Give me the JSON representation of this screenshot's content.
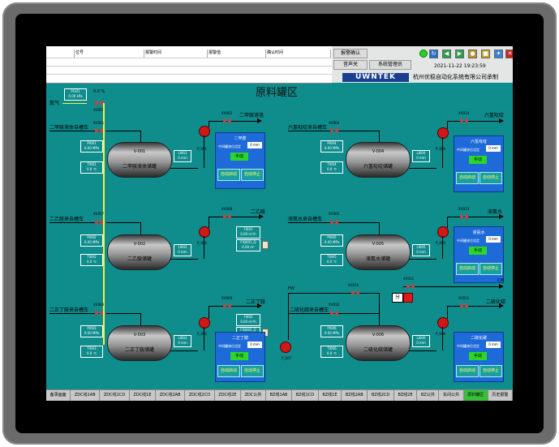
{
  "alarm_table": {
    "headers": [
      "位号",
      "报警时间",
      "报警值",
      "确认时间"
    ],
    "rows": [
      {
        "tag": "",
        "time": "",
        "value": "",
        "ack": ""
      }
    ]
  },
  "toolbar": {
    "alarm_confirm": "报警确认",
    "sound": "音声关",
    "sys_mgmt": "系统管理员",
    "datetime": "2021-11-22 19:23:59",
    "logo": "UWNTEK",
    "company": "杭州优稳自动化系统有限公司承制"
  },
  "page_title": "原料罐区",
  "tanks": [
    {
      "id": "V-001",
      "name": "二甲胺液体储罐",
      "inlet": "二甲胺液体自槽车",
      "valve_in": "XV001",
      "p_tag": "PI001",
      "p_val": "0.00 MPa",
      "t_tag": "TI001",
      "t_val": "0.0 ℃",
      "l_tag": "LI001",
      "l_val": "0 mm",
      "pump": "P_001",
      "valve_out": "XV002",
      "dest": "二甲胺溶液",
      "panel_title": "二甲胺",
      "panel_label": "中间罐液位设定",
      "panel_val": "0 mm",
      "mode": "手动",
      "start": "自动启动",
      "stop": "自动停止"
    },
    {
      "id": "V-002",
      "name": "二乙胺储罐",
      "inlet": "二乙胺来自槽车",
      "valve_in": "XV007",
      "p_tag": "PI002",
      "p_val": "0.00 MPa",
      "t_tag": "TI002",
      "t_val": "0.0 ℃",
      "l_tag": "LI002",
      "l_val": "0 mm",
      "pump": "P_002",
      "valve_out": "XV008",
      "dest": "二乙胺",
      "flow_tag": "FI001",
      "flow_val": "0.00 m³/h",
      "fq_tag": "FIQ001_Q",
      "fq_val": "0.00 m³"
    },
    {
      "id": "V-003",
      "name": "二正丁胺储罐",
      "inlet": "二正丁胺来自槽车",
      "valve_in": "XV003",
      "p_tag": "PI003",
      "p_val": "0.00 MPa",
      "t_tag": "TI003",
      "t_val": "0.0 ℃",
      "l_tag": "LI003",
      "l_val": "0 mm",
      "pump": "P_003",
      "valve_out": "XV009",
      "dest": "二正丁胺",
      "flow_tag": "FI002",
      "flow_val": "0.00 m³/h",
      "fq_tag": "FIQ002_Q",
      "fq_val": "0.00 m³",
      "panel_title": "二正丁胺",
      "panel_label": "中间罐液位设定",
      "panel_val": "0 mm",
      "mode": "手动",
      "start": "自动启动",
      "stop": "自动停止"
    },
    {
      "id": "V-004",
      "name": "六氢吡啶储罐",
      "inlet": "六氢吡啶来自槽车",
      "valve_in": "XV004",
      "p_tag": "PI004",
      "p_val": "0.00 MPa",
      "t_tag": "TI004",
      "t_val": "0.0 ℃",
      "l_tag": "LI004",
      "l_val": "0 mm",
      "pump": "P_004",
      "valve_out": "XV014",
      "dest": "六氢吡啶",
      "panel_title": "六氢吡啶",
      "panel_label": "中间罐液位设定",
      "panel_val": "0 mm",
      "mode": "手动",
      "start": "自动启动",
      "stop": "自动停止"
    },
    {
      "id": "V-005",
      "name": "液氨水储罐",
      "inlet": "液氨水来自槽车",
      "valve_in": "XV005",
      "p_tag": "PI005",
      "p_val": "0.00 MPa",
      "t_tag": "TI005",
      "t_val": "0.0 ℃",
      "l_tag": "LI005",
      "l_val": "0 mm",
      "pump": "P_005",
      "valve_out": "XV013",
      "dest": "液氨水",
      "panel_title": "液氨水",
      "panel_label": "中间罐液位设定",
      "panel_val": "0 mm",
      "mode": "手动",
      "start": "自动启动",
      "stop": "自动停止"
    },
    {
      "id": "V-006",
      "name": "二硫化碳储罐",
      "inlet": "二硫化碳来自槽车",
      "valve_in": "XV010",
      "p_tag": "PI006",
      "p_val": "0.00 MPa",
      "t_tag": "TI006",
      "t_val": "0.0 ℃",
      "l_tag": "LI006",
      "l_val": "0 mm",
      "pump": "P_006",
      "valve_out": "XV012",
      "dest": "二硫化碳",
      "panel_title": "二硫化碳",
      "panel_label": "中间罐液位设定",
      "panel_val": "0 mm",
      "mode": "手动",
      "start": "自动启动",
      "stop": "自动停止"
    }
  ],
  "nitrogen": {
    "label": "氮气",
    "valve": "XV001",
    "pressure_tag": "PI101",
    "pressure_val": "0.00 kPa",
    "sp": "0.0 %"
  },
  "cs2_misc": {
    "fw": "FW",
    "cw": "CW",
    "pump7": "P_007",
    "valve11": "XV011",
    "split": "分",
    "tag16": "XV016"
  },
  "tabs": [
    "备录画面",
    "ZDC线1AB",
    "ZDC线1CD",
    "ZDC线1E",
    "ZDC线2AB",
    "ZDC线2CD",
    "ZDC线2E",
    "ZDC公共",
    "BZ线1AB",
    "BZ线1CD",
    "BZ线1E",
    "BZ线2AB",
    "BZ线2CD",
    "BZ线2E",
    "BZ公共",
    "车间公共",
    "原料罐区",
    "历史报警"
  ],
  "active_tab": "原料罐区"
}
